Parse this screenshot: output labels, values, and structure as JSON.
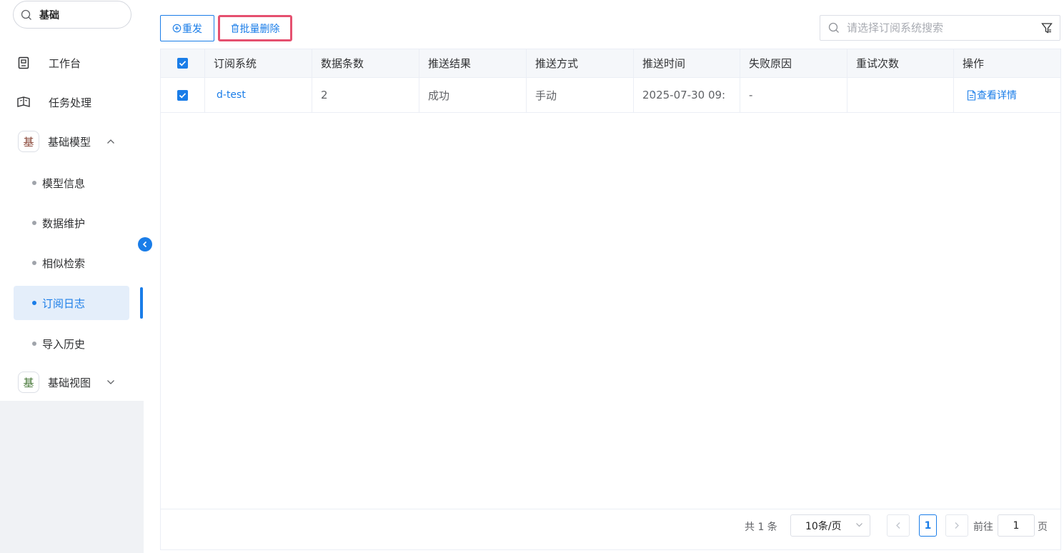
{
  "sidebar": {
    "search_value": "基础",
    "items": [
      {
        "label": "工作台",
        "icon": "workbench-icon"
      },
      {
        "label": "任务处理",
        "icon": "task-icon"
      }
    ],
    "groups": [
      {
        "badge": "基",
        "badge_color": "#8b4a3c",
        "label": "基础模型",
        "expanded": true
      },
      {
        "badge": "基",
        "badge_color": "#4a7a3c",
        "label": "基础视图",
        "expanded": false
      }
    ],
    "sub_items": [
      {
        "label": "模型信息"
      },
      {
        "label": "数据维护"
      },
      {
        "label": "相似检索"
      },
      {
        "label": "订阅日志",
        "active": true
      },
      {
        "label": "导入历史"
      }
    ]
  },
  "toolbar": {
    "resend_label": "重发",
    "batch_delete_label": "批量删除",
    "search_placeholder": "请选择订阅系统搜索"
  },
  "table": {
    "columns": [
      "订阅系统",
      "数据条数",
      "推送结果",
      "推送方式",
      "推送时间",
      "失败原因",
      "重试次数",
      "操作"
    ],
    "rows": [
      {
        "checked": true,
        "system": "d-test",
        "count": "2",
        "result": "成功",
        "method": "手动",
        "time": "2025-07-30 09:",
        "reason": "-",
        "retries": "",
        "action": "查看详情"
      }
    ]
  },
  "pagination": {
    "total_text": "共 1 条",
    "page_size": "10条/页",
    "current_page": "1",
    "goto_label": "前往",
    "goto_value": "1",
    "page_suffix": "页"
  },
  "colors": {
    "accent": "#1a7de8",
    "highlight_border": "#e5506f",
    "active_bg": "#e4eefa"
  }
}
